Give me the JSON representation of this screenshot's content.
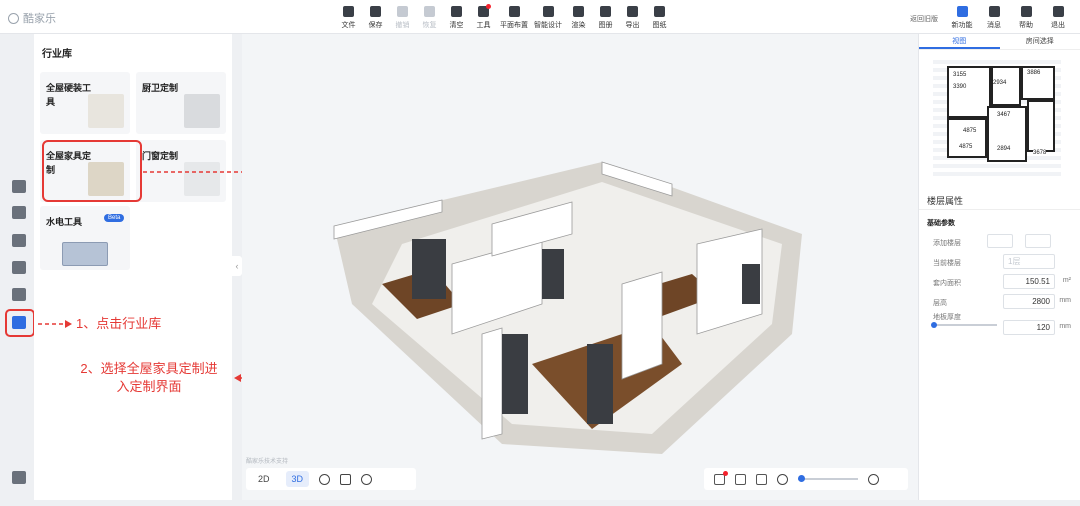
{
  "app": {
    "logo_text": "酷家乐"
  },
  "toolbar": {
    "items": [
      {
        "label": "文件",
        "icon": "file-icon",
        "enabled": true
      },
      {
        "label": "保存",
        "icon": "save-icon",
        "enabled": true
      },
      {
        "label": "撤销",
        "icon": "undo-icon",
        "enabled": false
      },
      {
        "label": "恢复",
        "icon": "redo-icon",
        "enabled": false
      },
      {
        "label": "清空",
        "icon": "eraser-icon",
        "enabled": true
      },
      {
        "label": "工具",
        "icon": "wrench-icon",
        "enabled": true,
        "dot": true
      },
      {
        "label": "平面布置",
        "icon": "layout-icon",
        "enabled": true
      },
      {
        "label": "智能设计",
        "icon": "lightning-icon",
        "enabled": true
      },
      {
        "label": "渲染",
        "icon": "camera-icon",
        "enabled": true
      },
      {
        "label": "图册",
        "icon": "album-icon",
        "enabled": true
      },
      {
        "label": "导出",
        "icon": "export-icon",
        "enabled": true
      },
      {
        "label": "图纸",
        "icon": "drawing-icon",
        "enabled": true
      }
    ],
    "back_link": "返回旧版",
    "right_items": [
      {
        "label": "新功能",
        "icon": "new-feature-icon"
      },
      {
        "label": "消息",
        "icon": "bell-icon"
      },
      {
        "label": "帮助",
        "icon": "help-icon"
      },
      {
        "label": "退出",
        "icon": "exit-icon"
      }
    ]
  },
  "library": {
    "title": "行业库",
    "cards": [
      {
        "label": "全屋硬装工具"
      },
      {
        "label": "厨卫定制"
      },
      {
        "label": "全屋家具定制"
      },
      {
        "label": "门窗定制"
      },
      {
        "label": "水电工具",
        "badge": "Beta"
      }
    ]
  },
  "annotations": {
    "step1": "1、点击行业库",
    "step2": "2、选择全屋家具定制进入定制界面",
    "color": "#e53935"
  },
  "canvas": {
    "watermark": "酷家乐技术支持",
    "view_2d": "2D",
    "view_3d": "3D"
  },
  "right_panel": {
    "tabs": [
      "视图",
      "房间选择"
    ],
    "floor_props_title": "楼层属性",
    "basic_params": "基础参数",
    "rows": {
      "add_floor": "添加楼层",
      "current_floor": "当前楼层",
      "current_floor_value": "1层",
      "indoor_area": "套内面积",
      "indoor_area_value": "150.51",
      "indoor_area_unit": "m²",
      "floor_height": "层高",
      "floor_height_value": "2800",
      "floor_height_unit": "mm",
      "slab_thickness": "地板厚度",
      "slab_thickness_value": "120",
      "slab_thickness_unit": "mm"
    },
    "minimap_labels": [
      "3155",
      "3390",
      "3886",
      "2934",
      "3467",
      "4875",
      "2894",
      "4875",
      "3678"
    ]
  },
  "colors": {
    "accent": "#2f6de1",
    "annotation": "#e53935"
  }
}
